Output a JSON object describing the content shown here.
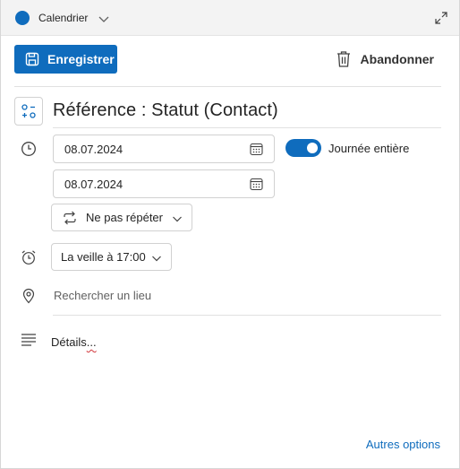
{
  "colors": {
    "accent": "#0f6cbd",
    "calendar_dot": "#0f6cbd",
    "link": "#0f6cbd"
  },
  "header": {
    "calendar_name": "Calendrier",
    "icons": [
      "chevron-down-icon",
      "expand-icon"
    ]
  },
  "toolbar": {
    "save_label": "Enregistrer",
    "discard_label": "Abandonner"
  },
  "event": {
    "title": "Référence : Statut (Contact)",
    "start_date": "08.07.2024",
    "end_date": "08.07.2024",
    "all_day_label": "Journée entière",
    "all_day": true,
    "repeat": "Ne pas répéter",
    "reminder": "La veille à 17:00",
    "location_placeholder": "Rechercher un lieu",
    "details_label": "Détails",
    "details_suffix": "..."
  },
  "footer": {
    "more_options": "Autres options"
  }
}
